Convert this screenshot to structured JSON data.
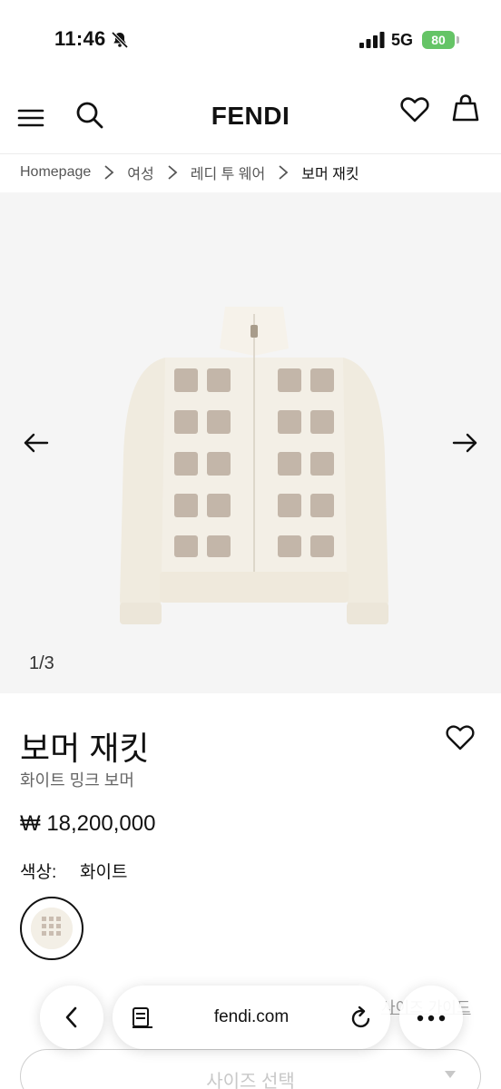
{
  "status_bar": {
    "time": "11:46",
    "network": "5G",
    "battery": "80"
  },
  "header": {
    "logo": "FENDI"
  },
  "breadcrumb": [
    "Homepage",
    "여성",
    "레디 투 웨어",
    "보머 재킷"
  ],
  "gallery": {
    "counter": "1/3",
    "image_alt": "FF motif white mink bomber jacket"
  },
  "product": {
    "title": "보머 재킷",
    "subtitle": "화이트 밍크 보머",
    "price": "₩ 18,200,000",
    "color_label": "색상:",
    "color_value": "화이트"
  },
  "size": {
    "guide_label": "사이즈 가이드",
    "select_label": "사이즈 선택"
  },
  "browser": {
    "url": "fendi.com"
  },
  "colors": {
    "battery_green": "#65c466",
    "gallery_bg": "#f5f5f5",
    "jacket_cream": "#f3efe6",
    "ff_taupe": "#b8a99a"
  }
}
